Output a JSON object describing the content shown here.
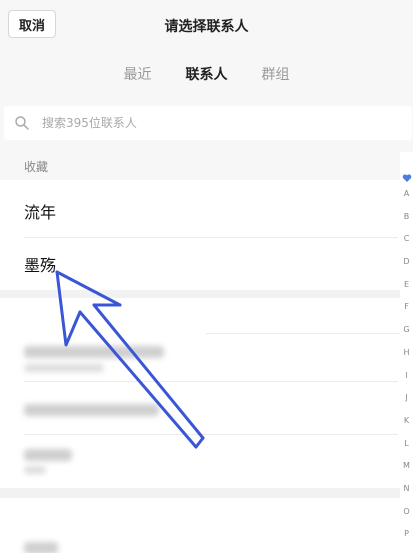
{
  "header": {
    "cancel_label": "取消",
    "title": "请选择联系人"
  },
  "tabs": [
    {
      "label": "最近",
      "active": false
    },
    {
      "label": "联系人",
      "active": true
    },
    {
      "label": "群组",
      "active": false
    }
  ],
  "search": {
    "placeholder": "搜索395位联系人",
    "icon": "search-icon"
  },
  "favorites": {
    "header": "收藏",
    "items": [
      {
        "name": "流年"
      },
      {
        "name": "墨殇"
      }
    ]
  },
  "index_bar": {
    "favorite_icon": "heart-icon",
    "letters": [
      "A",
      "B",
      "C",
      "D",
      "E",
      "F",
      "G",
      "H",
      "I",
      "J",
      "K",
      "L",
      "M",
      "N",
      "O",
      "P"
    ]
  },
  "colors": {
    "background": "#f7f7f7",
    "accent_blue": "#3a56d6",
    "index_heart": "#4a7fe0",
    "text_primary": "#222222",
    "text_secondary": "#888888"
  }
}
